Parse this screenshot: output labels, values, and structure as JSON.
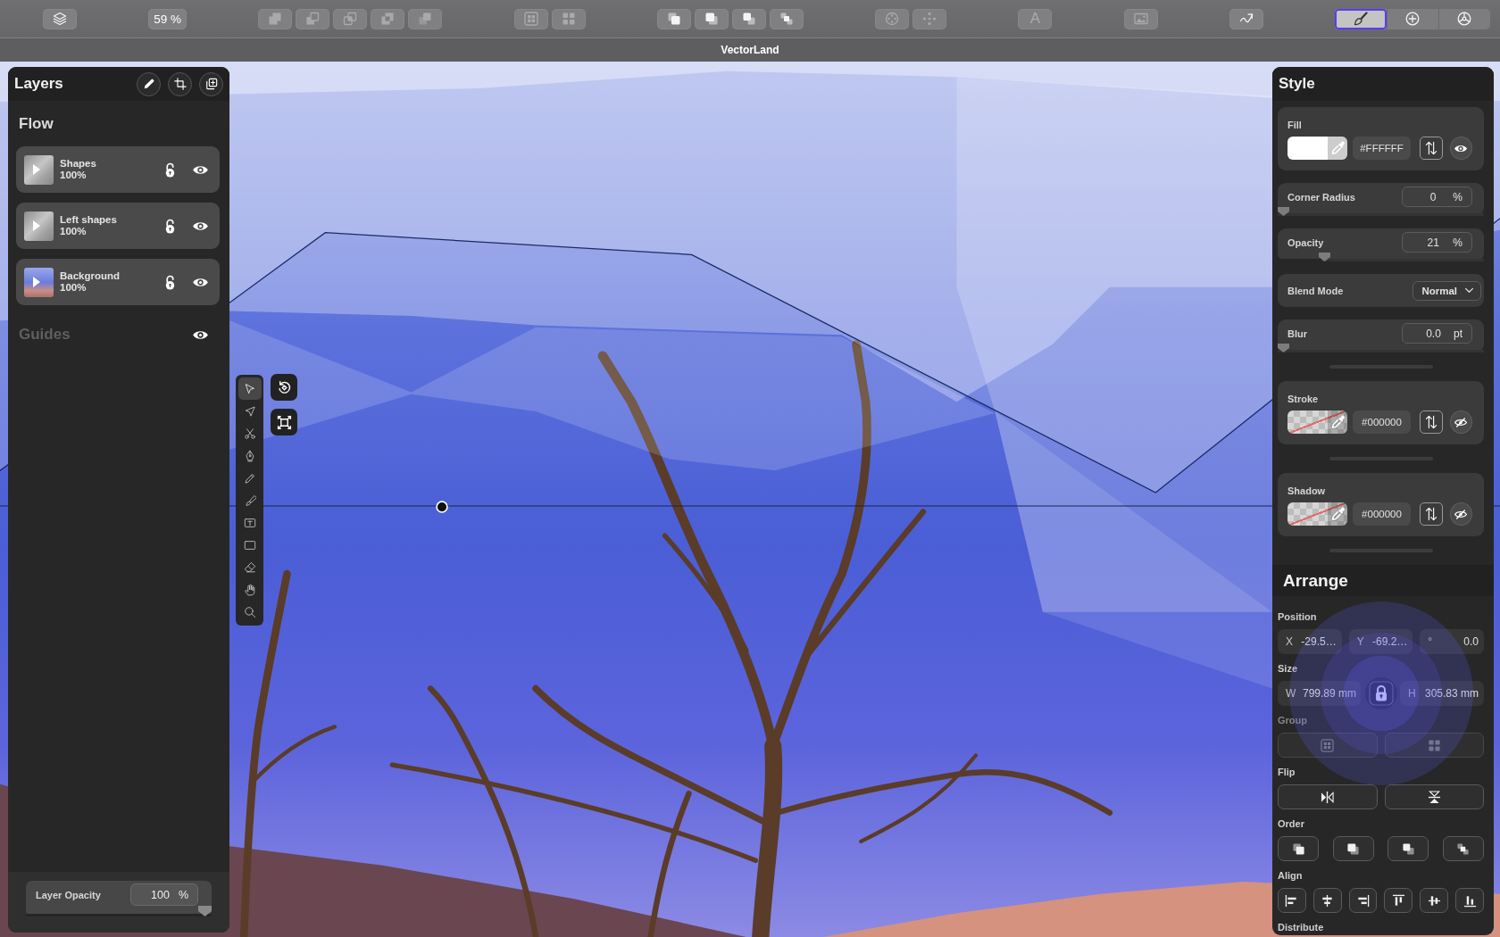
{
  "toolbar": {
    "layers_button": {
      "disabled": false
    },
    "zoom": "59 %",
    "shape_buttons": [
      {
        "disabled": true
      },
      {
        "disabled": true
      },
      {
        "disabled": true
      },
      {
        "disabled": true
      },
      {
        "disabled": true
      }
    ],
    "group_buttons": [
      {
        "disabled": true
      },
      {
        "disabled": true
      }
    ],
    "arrange_buttons": [
      {
        "disabled": false
      },
      {
        "disabled": false
      },
      {
        "disabled": false
      },
      {
        "disabled": false
      }
    ],
    "transform_buttons": [
      {
        "disabled": true
      },
      {
        "disabled": true
      }
    ],
    "text_button": {
      "label": "A",
      "disabled": true
    },
    "image_button": {
      "disabled": true
    },
    "path_button": {
      "disabled": false
    },
    "inspector_tabs": [
      {
        "selected": true
      },
      {
        "selected": false
      },
      {
        "selected": false
      }
    ]
  },
  "window": {
    "title": "VectorLand"
  },
  "layers_panel": {
    "title": "Layers",
    "group_name": "Flow",
    "layers": [
      {
        "name": "Shapes",
        "opacity": "100%",
        "kind": "shapes",
        "locked": false,
        "visible": true
      },
      {
        "name": "Left shapes",
        "opacity": "100%",
        "kind": "shapes",
        "locked": false,
        "visible": true
      },
      {
        "name": "Background",
        "opacity": "100%",
        "kind": "photo",
        "locked": false,
        "visible": true
      }
    ],
    "guides": {
      "label": "Guides",
      "disabled": true,
      "visible": true
    },
    "layer_opacity": {
      "label": "Layer Opacity",
      "value": "100",
      "unit": "%",
      "level": 1
    }
  },
  "tools": [
    {
      "selected": true
    },
    {
      "selected": false
    },
    {
      "selected": false
    },
    {
      "selected": false
    },
    {
      "selected": false
    },
    {
      "selected": false
    },
    {
      "selected": false
    },
    {
      "selected": false
    },
    {
      "selected": false
    },
    {
      "selected": false
    },
    {
      "selected": false
    }
  ],
  "style_panel": {
    "title": "Style",
    "sections": [
      {
        "rows": [
          {
            "kind": "paint",
            "label": "Fill",
            "hex": "#FFFFFF",
            "color": "#ffffff",
            "visible": true
          },
          {
            "kind": "slider",
            "label": "Corner Radius",
            "value": "0",
            "unit": "%",
            "level": 0
          },
          {
            "kind": "slider",
            "label": "Opacity",
            "value": "21",
            "unit": "%",
            "level": 0.21
          },
          {
            "kind": "dropdown",
            "label": "Blend Mode",
            "value": "Normal"
          },
          {
            "kind": "slider",
            "label": "Blur",
            "value": "0.0",
            "unit": "pt",
            "level": 0
          }
        ]
      },
      {
        "rows": [
          {
            "kind": "paint",
            "label": "Stroke",
            "hex": "#000000",
            "visible": false
          }
        ]
      },
      {
        "rows": [
          {
            "kind": "paint",
            "label": "Shadow",
            "hex": "#000000",
            "visible": false
          }
        ]
      }
    ]
  },
  "arrange_panel": {
    "title": "Arrange",
    "position": {
      "label": "Position",
      "fields": [
        {
          "prefix": "X",
          "value": "-29.5…"
        },
        {
          "prefix": "Y",
          "value": "-69.2…"
        },
        {
          "prefix": "°",
          "value": "0.0"
        }
      ]
    },
    "size": {
      "label": "Size",
      "fields": [
        {
          "prefix": "W",
          "value": "799.89 mm"
        },
        {
          "prefix": "H",
          "value": "305.83 mm"
        }
      ],
      "locked": true
    },
    "group": {
      "label": "Group",
      "disabled": true
    },
    "flip": {
      "label": "Flip",
      "disabled": false
    },
    "order": {
      "label": "Order"
    },
    "align": {
      "label": "Align"
    },
    "distribute": {
      "label": "Distribute"
    }
  }
}
